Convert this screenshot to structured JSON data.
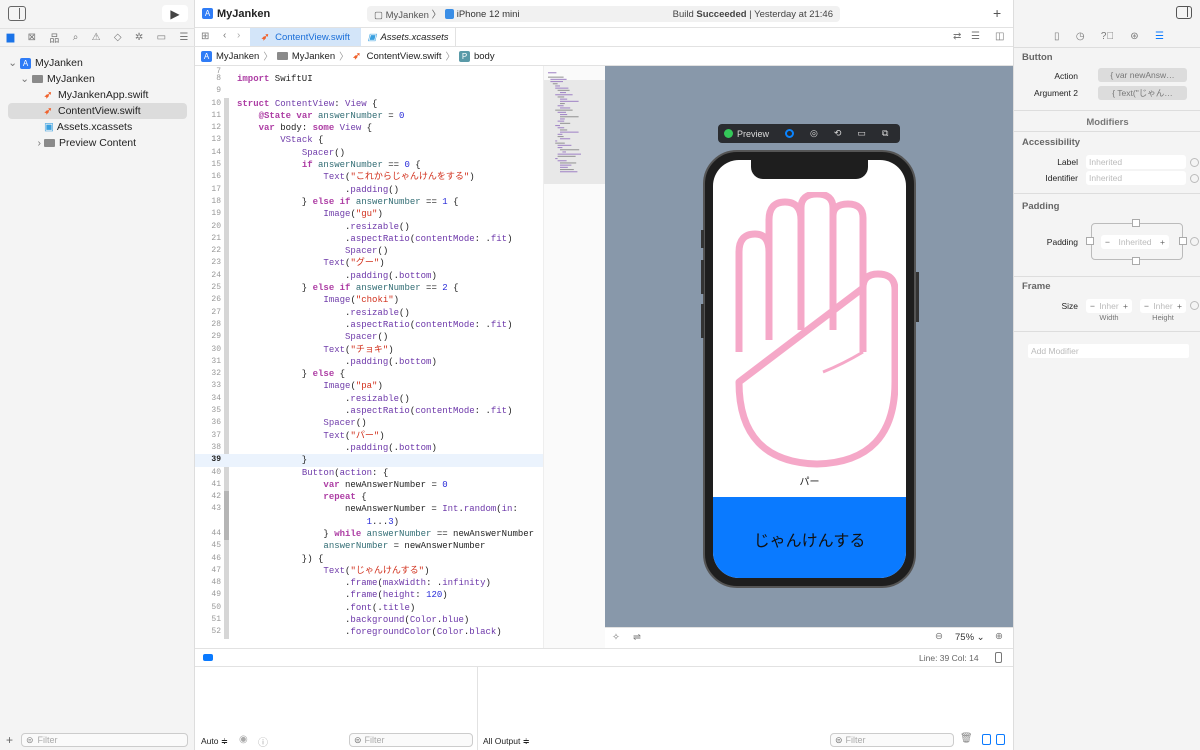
{
  "project": {
    "name": "MyJanken"
  },
  "toolbar": {
    "scheme": "MyJanken",
    "device": "iPhone 12 mini",
    "status_prefix": "Build ",
    "status_strong": "Succeeded",
    "status_time": " | Yesterday at 21:46"
  },
  "navigator": {
    "items": [
      {
        "label": "MyJanken",
        "type": "project"
      },
      {
        "label": "MyJanken",
        "type": "folder"
      },
      {
        "label": "MyJankenApp.swift",
        "type": "swift"
      },
      {
        "label": "ContentView.swift",
        "type": "swift",
        "selected": true
      },
      {
        "label": "Assets.xcassets",
        "type": "assets"
      },
      {
        "label": "Preview Content",
        "type": "folder"
      }
    ],
    "filter_placeholder": "Filter"
  },
  "tabs": [
    {
      "label": "ContentView.swift",
      "active": true
    },
    {
      "label": "Assets.xcassets",
      "active": false
    }
  ],
  "breadcrumb": [
    "MyJanken",
    "MyJanken",
    "ContentView.swift",
    "body"
  ],
  "editor": {
    "current_line": 39,
    "lines": [
      {
        "n": "7",
        "t": []
      },
      {
        "n": "8",
        "t": [
          [
            "k",
            "import"
          ],
          [
            "p",
            " SwiftUI"
          ]
        ]
      },
      {
        "n": "9",
        "t": []
      },
      {
        "n": "10",
        "t": [
          [
            "k",
            "struct"
          ],
          [
            "p",
            " "
          ],
          [
            "t",
            "ContentView"
          ],
          [
            "p",
            ": "
          ],
          [
            "t",
            "View"
          ],
          [
            "p",
            " {"
          ]
        ]
      },
      {
        "n": "11",
        "t": [
          [
            "p",
            "    "
          ],
          [
            "k",
            "@State"
          ],
          [
            "p",
            " "
          ],
          [
            "k",
            "var"
          ],
          [
            "p",
            " "
          ],
          [
            "v",
            "answerNumber"
          ],
          [
            "p",
            " = "
          ],
          [
            "n",
            "0"
          ]
        ]
      },
      {
        "n": "12",
        "t": [
          [
            "p",
            "    "
          ],
          [
            "k",
            "var"
          ],
          [
            "p",
            " body: "
          ],
          [
            "k",
            "some"
          ],
          [
            "p",
            " "
          ],
          [
            "t",
            "View"
          ],
          [
            "p",
            " {"
          ]
        ]
      },
      {
        "n": "13",
        "t": [
          [
            "p",
            "        "
          ],
          [
            "t",
            "VStack"
          ],
          [
            "p",
            " {"
          ]
        ]
      },
      {
        "n": "14",
        "t": [
          [
            "p",
            "            "
          ],
          [
            "t",
            "Spacer"
          ],
          [
            "p",
            "()"
          ]
        ]
      },
      {
        "n": "15",
        "t": [
          [
            "p",
            "            "
          ],
          [
            "k",
            "if"
          ],
          [
            "p",
            " "
          ],
          [
            "v",
            "answerNumber"
          ],
          [
            "p",
            " == "
          ],
          [
            "n",
            "0"
          ],
          [
            "p",
            " {"
          ]
        ]
      },
      {
        "n": "16",
        "t": [
          [
            "p",
            "                "
          ],
          [
            "t",
            "Text"
          ],
          [
            "p",
            "("
          ],
          [
            "s",
            "\"これからじゃんけんをする\""
          ],
          [
            "p",
            ")"
          ]
        ]
      },
      {
        "n": "17",
        "t": [
          [
            "p",
            "                    ."
          ],
          [
            "m",
            "padding"
          ],
          [
            "p",
            "()"
          ]
        ]
      },
      {
        "n": "18",
        "t": [
          [
            "p",
            "            } "
          ],
          [
            "k",
            "else if"
          ],
          [
            "p",
            " "
          ],
          [
            "v",
            "answerNumber"
          ],
          [
            "p",
            " == "
          ],
          [
            "n",
            "1"
          ],
          [
            "p",
            " {"
          ]
        ]
      },
      {
        "n": "19",
        "t": [
          [
            "p",
            "                "
          ],
          [
            "t",
            "Image"
          ],
          [
            "p",
            "("
          ],
          [
            "s",
            "\"gu\""
          ],
          [
            "p",
            ")"
          ]
        ]
      },
      {
        "n": "20",
        "t": [
          [
            "p",
            "                    ."
          ],
          [
            "m",
            "resizable"
          ],
          [
            "p",
            "()"
          ]
        ]
      },
      {
        "n": "21",
        "t": [
          [
            "p",
            "                    ."
          ],
          [
            "m",
            "aspectRatio"
          ],
          [
            "p",
            "("
          ],
          [
            "m",
            "contentMode"
          ],
          [
            "p",
            ": ."
          ],
          [
            "m",
            "fit"
          ],
          [
            "p",
            ")"
          ]
        ]
      },
      {
        "n": "22",
        "t": [
          [
            "p",
            "                    "
          ],
          [
            "t",
            "Spacer"
          ],
          [
            "p",
            "()"
          ]
        ]
      },
      {
        "n": "23",
        "t": [
          [
            "p",
            "                "
          ],
          [
            "t",
            "Text"
          ],
          [
            "p",
            "("
          ],
          [
            "s",
            "\"グー\""
          ],
          [
            "p",
            ")"
          ]
        ]
      },
      {
        "n": "24",
        "t": [
          [
            "p",
            "                    ."
          ],
          [
            "m",
            "padding"
          ],
          [
            "p",
            "(."
          ],
          [
            "m",
            "bottom"
          ],
          [
            "p",
            ")"
          ]
        ]
      },
      {
        "n": "25",
        "t": [
          [
            "p",
            "            } "
          ],
          [
            "k",
            "else if"
          ],
          [
            "p",
            " "
          ],
          [
            "v",
            "answerNumber"
          ],
          [
            "p",
            " == "
          ],
          [
            "n",
            "2"
          ],
          [
            "p",
            " {"
          ]
        ]
      },
      {
        "n": "26",
        "t": [
          [
            "p",
            "                "
          ],
          [
            "t",
            "Image"
          ],
          [
            "p",
            "("
          ],
          [
            "s",
            "\"choki\""
          ],
          [
            "p",
            ")"
          ]
        ]
      },
      {
        "n": "27",
        "t": [
          [
            "p",
            "                    ."
          ],
          [
            "m",
            "resizable"
          ],
          [
            "p",
            "()"
          ]
        ]
      },
      {
        "n": "28",
        "t": [
          [
            "p",
            "                    ."
          ],
          [
            "m",
            "aspectRatio"
          ],
          [
            "p",
            "("
          ],
          [
            "m",
            "contentMode"
          ],
          [
            "p",
            ": ."
          ],
          [
            "m",
            "fit"
          ],
          [
            "p",
            ")"
          ]
        ]
      },
      {
        "n": "29",
        "t": [
          [
            "p",
            "                    "
          ],
          [
            "t",
            "Spacer"
          ],
          [
            "p",
            "()"
          ]
        ]
      },
      {
        "n": "30",
        "t": [
          [
            "p",
            "                "
          ],
          [
            "t",
            "Text"
          ],
          [
            "p",
            "("
          ],
          [
            "s",
            "\"チョキ\""
          ],
          [
            "p",
            ")"
          ]
        ]
      },
      {
        "n": "31",
        "t": [
          [
            "p",
            "                    ."
          ],
          [
            "m",
            "padding"
          ],
          [
            "p",
            "(."
          ],
          [
            "m",
            "bottom"
          ],
          [
            "p",
            ")"
          ]
        ]
      },
      {
        "n": "32",
        "t": [
          [
            "p",
            "            } "
          ],
          [
            "k",
            "else"
          ],
          [
            "p",
            " {"
          ]
        ]
      },
      {
        "n": "33",
        "t": [
          [
            "p",
            "                "
          ],
          [
            "t",
            "Image"
          ],
          [
            "p",
            "("
          ],
          [
            "s",
            "\"pa\""
          ],
          [
            "p",
            ")"
          ]
        ]
      },
      {
        "n": "34",
        "t": [
          [
            "p",
            "                    ."
          ],
          [
            "m",
            "resizable"
          ],
          [
            "p",
            "()"
          ]
        ]
      },
      {
        "n": "35",
        "t": [
          [
            "p",
            "                    ."
          ],
          [
            "m",
            "aspectRatio"
          ],
          [
            "p",
            "("
          ],
          [
            "m",
            "contentMode"
          ],
          [
            "p",
            ": ."
          ],
          [
            "m",
            "fit"
          ],
          [
            "p",
            ")"
          ]
        ]
      },
      {
        "n": "36",
        "t": [
          [
            "p",
            "                "
          ],
          [
            "t",
            "Spacer"
          ],
          [
            "p",
            "()"
          ]
        ]
      },
      {
        "n": "37",
        "t": [
          [
            "p",
            "                "
          ],
          [
            "t",
            "Text"
          ],
          [
            "p",
            "("
          ],
          [
            "s",
            "\"パー\""
          ],
          [
            "p",
            ")"
          ]
        ]
      },
      {
        "n": "38",
        "t": [
          [
            "p",
            "                    ."
          ],
          [
            "m",
            "padding"
          ],
          [
            "p",
            "(."
          ],
          [
            "m",
            "bottom"
          ],
          [
            "p",
            ")"
          ]
        ]
      },
      {
        "n": "39",
        "t": [
          [
            "p",
            "            }"
          ]
        ]
      },
      {
        "n": "40",
        "t": [
          [
            "p",
            "            "
          ],
          [
            "t",
            "Button"
          ],
          [
            "p",
            "("
          ],
          [
            "m",
            "action"
          ],
          [
            "p",
            ": {"
          ]
        ]
      },
      {
        "n": "41",
        "t": [
          [
            "p",
            "                "
          ],
          [
            "k",
            "var"
          ],
          [
            "p",
            " newAnswerNumber = "
          ],
          [
            "n",
            "0"
          ]
        ]
      },
      {
        "n": "42",
        "t": [
          [
            "p",
            "                "
          ],
          [
            "k",
            "repeat"
          ],
          [
            "p",
            " {"
          ]
        ]
      },
      {
        "n": "43",
        "t": [
          [
            "p",
            "                    newAnswerNumber = "
          ],
          [
            "t",
            "Int"
          ],
          [
            "p",
            "."
          ],
          [
            "m",
            "random"
          ],
          [
            "p",
            "("
          ],
          [
            "m",
            "in"
          ],
          [
            "p",
            ":"
          ]
        ]
      },
      {
        "n": "",
        "t": [
          [
            "p",
            "                        "
          ],
          [
            "n",
            "1"
          ],
          [
            "p",
            "..."
          ],
          [
            "n",
            "3"
          ],
          [
            "p",
            ")"
          ]
        ]
      },
      {
        "n": "44",
        "t": [
          [
            "p",
            "                } "
          ],
          [
            "k",
            "while"
          ],
          [
            "p",
            " "
          ],
          [
            "v",
            "answerNumber"
          ],
          [
            "p",
            " == newAnswerNumber"
          ]
        ]
      },
      {
        "n": "45",
        "t": [
          [
            "p",
            "                "
          ],
          [
            "v",
            "answerNumber"
          ],
          [
            "p",
            " = newAnswerNumber"
          ]
        ]
      },
      {
        "n": "46",
        "t": [
          [
            "p",
            "            }) {"
          ]
        ]
      },
      {
        "n": "47",
        "t": [
          [
            "p",
            "                "
          ],
          [
            "t",
            "Text"
          ],
          [
            "p",
            "("
          ],
          [
            "s",
            "\"じゃんけんする\""
          ],
          [
            "p",
            ")"
          ]
        ]
      },
      {
        "n": "48",
        "t": [
          [
            "p",
            "                    ."
          ],
          [
            "m",
            "frame"
          ],
          [
            "p",
            "("
          ],
          [
            "m",
            "maxWidth"
          ],
          [
            "p",
            ": ."
          ],
          [
            "m",
            "infinity"
          ],
          [
            "p",
            ")"
          ]
        ]
      },
      {
        "n": "49",
        "t": [
          [
            "p",
            "                    ."
          ],
          [
            "m",
            "frame"
          ],
          [
            "p",
            "("
          ],
          [
            "m",
            "height"
          ],
          [
            "p",
            ": "
          ],
          [
            "n",
            "120"
          ],
          [
            "p",
            ")"
          ]
        ]
      },
      {
        "n": "50",
        "t": [
          [
            "p",
            "                    ."
          ],
          [
            "m",
            "font"
          ],
          [
            "p",
            "(."
          ],
          [
            "m",
            "title"
          ],
          [
            "p",
            ")"
          ]
        ]
      },
      {
        "n": "51",
        "t": [
          [
            "p",
            "                    ."
          ],
          [
            "m",
            "background"
          ],
          [
            "p",
            "("
          ],
          [
            "t",
            "Color"
          ],
          [
            "p",
            "."
          ],
          [
            "m",
            "blue"
          ],
          [
            "p",
            ")"
          ]
        ]
      },
      {
        "n": "52",
        "t": [
          [
            "p",
            "                    ."
          ],
          [
            "m",
            "foregroundColor"
          ],
          [
            "p",
            "("
          ],
          [
            "t",
            "Color"
          ],
          [
            "p",
            "."
          ],
          [
            "m",
            "black"
          ],
          [
            "p",
            ")"
          ]
        ]
      }
    ]
  },
  "preview": {
    "label": "Preview",
    "hand_label": "パー",
    "button_label": "じゃんけんする",
    "zoom": "75%",
    "hand_color": "#f5a8c8",
    "button_color": "#0a7aff"
  },
  "status": {
    "line_col": "Line: 39  Col: 14"
  },
  "console": {
    "mode": "Auto ≑",
    "output": "All Output ≑",
    "filter_placeholder": "Filter"
  },
  "inspector": {
    "title": "Button",
    "action_label": "Action",
    "action_value": "{ var newAnsw…",
    "arg2_label": "Argument 2",
    "arg2_value": "{ Text(\"じゃん…",
    "modifiers": "Modifiers",
    "accessibility": "Accessibility",
    "a11y_label": "Label",
    "a11y_identifier": "Identifier",
    "inherited": "Inherited",
    "padding_section": "Padding",
    "padding_label": "Padding",
    "frame_section": "Frame",
    "size_label": "Size",
    "inher": "Inher",
    "width": "Width",
    "height": "Height",
    "add_modifier": "Add Modifier"
  }
}
